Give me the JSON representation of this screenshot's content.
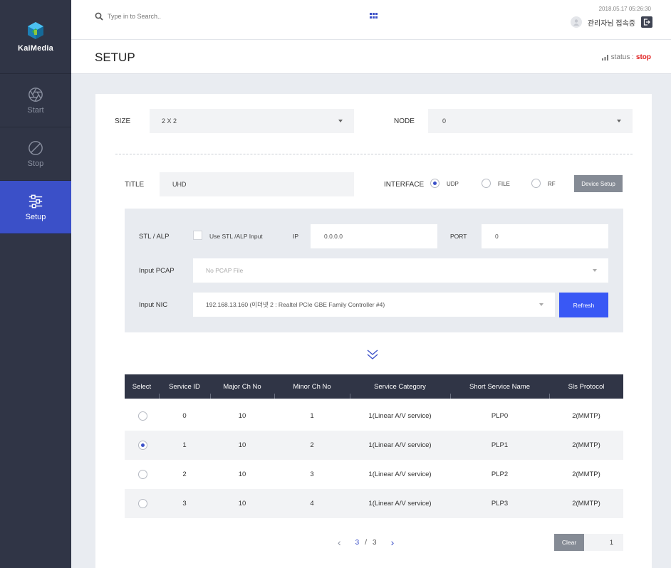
{
  "app": {
    "name": "KaiMedia"
  },
  "nav": [
    {
      "label": "Start",
      "icon": "aperture-icon",
      "active": false
    },
    {
      "label": "Stop",
      "icon": "stop-circle-icon",
      "active": false
    },
    {
      "label": "Setup",
      "icon": "sliders-icon",
      "active": true
    }
  ],
  "topbar": {
    "search_placeholder": "Type in to Search..",
    "datetime": "2018.05.17  05:26:30",
    "user": "관리자님 접속중"
  },
  "page": {
    "title": "SETUP",
    "status_label": "status :",
    "status_value": "stop",
    "status_color": "#e02020"
  },
  "form": {
    "size_label": "SIZE",
    "size_value": "2 X 2",
    "node_label": "NODE",
    "node_value": "0",
    "title_label": "TITLE",
    "title_value": "UHD",
    "interface_label": "INTERFACE",
    "interface_options": [
      {
        "label": "UDP",
        "selected": true
      },
      {
        "label": "FILE",
        "selected": false
      },
      {
        "label": "RF",
        "selected": false
      }
    ],
    "device_setup": "Device Setup"
  },
  "panel": {
    "stl_label": "STL / ALP",
    "stl_checkbox_label": "Use STL /ALP Input",
    "stl_checked": false,
    "ip_label": "IP",
    "ip_value": "0.0.0.0",
    "port_label": "PORT",
    "port_value": "0",
    "pcap_label": "Input PCAP",
    "pcap_placeholder": "No PCAP File",
    "nic_label": "Input NIC",
    "nic_value": "192.168.13.160    (이더넷 2 : Realtel PCIe GBE Family Controller #4)",
    "refresh": "Refresh"
  },
  "table": {
    "headers": [
      "Select",
      "Service ID",
      "Major Ch No",
      "Minor Ch No",
      "Service Category",
      "Short Service Name",
      "Sls Protocol"
    ],
    "rows": [
      {
        "selected": false,
        "service_id": "0",
        "major": "10",
        "minor": "1",
        "category": "1(Linear A/V service)",
        "name": "PLP0",
        "protocol": "2(MMTP)"
      },
      {
        "selected": true,
        "service_id": "1",
        "major": "10",
        "minor": "2",
        "category": "1(Linear A/V service)",
        "name": "PLP1",
        "protocol": "2(MMTP)"
      },
      {
        "selected": false,
        "service_id": "2",
        "major": "10",
        "minor": "3",
        "category": "1(Linear A/V service)",
        "name": "PLP2",
        "protocol": "2(MMTP)"
      },
      {
        "selected": false,
        "service_id": "3",
        "major": "10",
        "minor": "4",
        "category": "1(Linear A/V service)",
        "name": "PLP3",
        "protocol": "2(MMTP)"
      }
    ]
  },
  "pagination": {
    "current": "3",
    "sep": "/",
    "total": "3",
    "clear": "Clear",
    "page_input": "1"
  },
  "colors": {
    "accent": "#3b50c8",
    "button_blue": "#3958f5",
    "sidebar": "#303546"
  }
}
